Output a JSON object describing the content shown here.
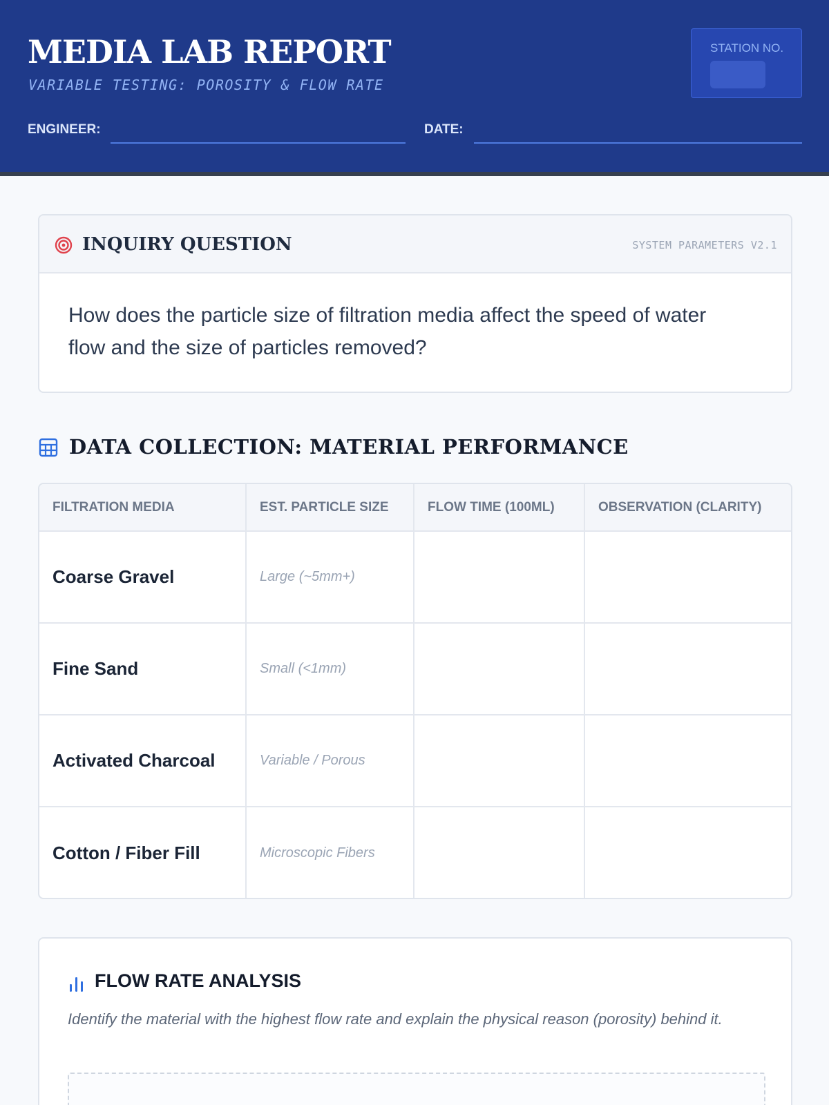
{
  "header": {
    "title": "MEDIA LAB REPORT",
    "subtitle": "VARIABLE TESTING: POROSITY & FLOW RATE",
    "station_label": "STATION NO.",
    "engineer_label": "ENGINEER:",
    "date_label": "DATE:"
  },
  "inquiry": {
    "title": "INQUIRY QUESTION",
    "system_tag": "SYSTEM PARAMETERS V2.1",
    "question": "How does the particle size of filtration media affect the speed of water flow and the size of particles removed?",
    "icon": "target-icon"
  },
  "data_collection": {
    "title": "DATA COLLECTION: MATERIAL PERFORMANCE",
    "icon": "grid-icon",
    "columns": [
      "Filtration Media",
      "Est. Particle Size",
      "Flow Time (100mL)",
      "Observation (Clarity)"
    ],
    "rows": [
      {
        "media": "Coarse Gravel",
        "size": "Large (~5mm+)",
        "flow_time": "",
        "observation": ""
      },
      {
        "media": "Fine Sand",
        "size": "Small (<1mm)",
        "flow_time": "",
        "observation": ""
      },
      {
        "media": "Activated Charcoal",
        "size": "Variable / Porous",
        "flow_time": "",
        "observation": ""
      },
      {
        "media": "Cotton / Fiber Fill",
        "size": "Microscopic Fibers",
        "flow_time": "",
        "observation": ""
      }
    ]
  },
  "analysis": {
    "title": "FLOW RATE ANALYSIS",
    "icon": "bar-chart-icon",
    "prompt": "Identify the material with the highest flow rate and explain the physical reason (porosity) behind it."
  },
  "colors": {
    "header_bg": "#1f3a8a",
    "accent_light": "#93b4f5",
    "target_red": "#e0424c",
    "icon_blue": "#2f6fe0"
  }
}
